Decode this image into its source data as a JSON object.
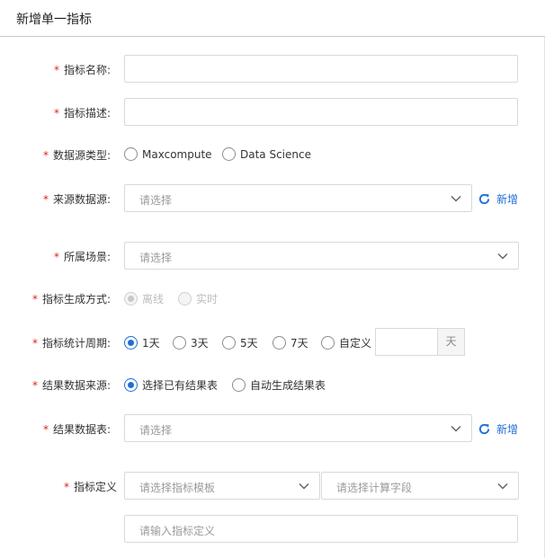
{
  "header": {
    "title": "新增单一指标"
  },
  "form": {
    "name": {
      "label": "指标名称:"
    },
    "desc": {
      "label": "指标描述:"
    },
    "source_type": {
      "label": "数据源类型:",
      "options": [
        "Maxcompute",
        "Data Science"
      ],
      "selected": null
    },
    "source": {
      "label": "来源数据源:",
      "placeholder": "请选择",
      "add_label": "新增"
    },
    "scene": {
      "label": "所属场景:",
      "placeholder": "请选择"
    },
    "gen_mode": {
      "label": "指标生成方式:",
      "options": [
        "离线",
        "实时"
      ],
      "selected": "离线",
      "disabled": true
    },
    "period": {
      "label": "指标统计周期:",
      "options": [
        "1天",
        "3天",
        "5天",
        "7天",
        "自定义"
      ],
      "selected": "1天",
      "custom_unit": "天"
    },
    "result_source": {
      "label": "结果数据来源:",
      "options": [
        "选择已有结果表",
        "自动生成结果表"
      ],
      "selected": "选择已有结果表"
    },
    "result_table": {
      "label": "结果数据表:",
      "placeholder": "请选择",
      "add_label": "新增"
    },
    "definition": {
      "label": "指标定义",
      "template_placeholder": "请选择指标模板",
      "field_placeholder": "请选择计算字段",
      "input_placeholder": "请输入指标定义"
    }
  },
  "required_mark": "*",
  "colors": {
    "accent": "#1f6fd6",
    "required": "#e0221a",
    "border": "#d9d9d9",
    "placeholder": "#9a9a9a"
  },
  "icons": {
    "select_arrow": "chevron-down-icon",
    "refresh": "refresh-icon"
  }
}
